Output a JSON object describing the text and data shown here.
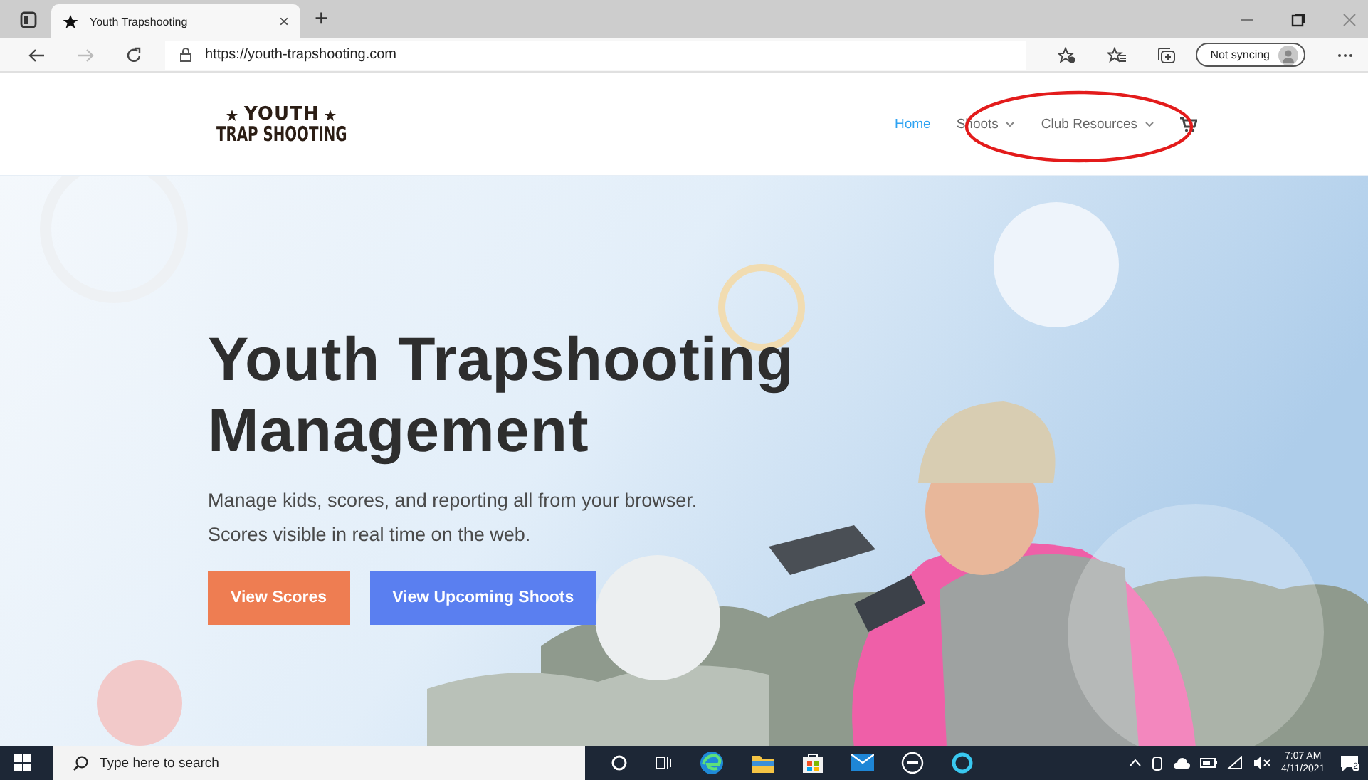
{
  "browser": {
    "tab": {
      "title": "Youth Trapshooting",
      "close": "×",
      "selected": true
    },
    "new_tab": "+",
    "url": "https://youth-trapshooting.com",
    "sync_button": "Not syncing"
  },
  "site": {
    "logo": {
      "line_1": "YOUTH",
      "line_2": "TRAP SHOOTING"
    },
    "nav": [
      {
        "label": "Home",
        "selected": true,
        "dropdown": false
      },
      {
        "label": "Shoots",
        "selected": false,
        "dropdown": true
      },
      {
        "label": "Club Resources",
        "selected": false,
        "dropdown": true
      }
    ]
  },
  "hero": {
    "kind": "picture",
    "title": "Youth Trapshooting Management",
    "lines": [
      "Manage kids, scores, and reporting all from your browser.",
      "Scores visible in real time on the web."
    ],
    "buttons": [
      {
        "label": "View Scores",
        "color": "#ee7d52"
      },
      {
        "label": "View Upcoming Shoots",
        "color": "#5a7ff0"
      }
    ]
  },
  "annotation": {
    "kind": "ellipse",
    "color": "#e31b1b"
  },
  "taskbar": {
    "search_placeholder": "Type here to search",
    "time": "7:07 AM",
    "date": "4/11/2021",
    "notifications": "2"
  }
}
